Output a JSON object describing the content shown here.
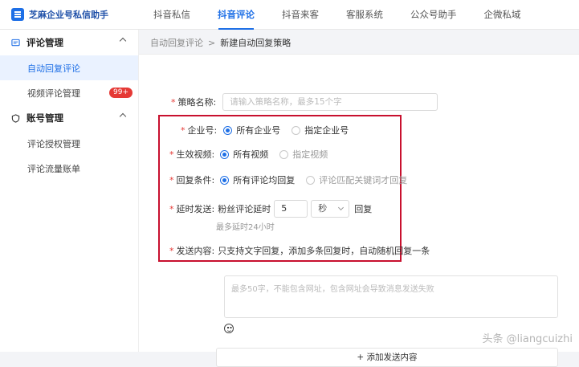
{
  "brand": {
    "name": "芝麻企业号私信助手"
  },
  "nav": [
    "抖音私信",
    "抖音评论",
    "抖音来客",
    "客服系统",
    "公众号助手",
    "企微私域"
  ],
  "nav_active_index": 1,
  "sidebar": {
    "group1": {
      "label": "评论管理",
      "icon": "comment-icon"
    },
    "items1": [
      {
        "label": "自动回复评论",
        "active": true
      },
      {
        "label": "视频评论管理",
        "badge": "99+"
      }
    ],
    "group2": {
      "label": "账号管理",
      "icon": "shield-icon"
    },
    "items2": [
      {
        "label": "评论授权管理"
      },
      {
        "label": "评论流量账单"
      }
    ]
  },
  "breadcrumb": {
    "parent": "自动回复评论",
    "sep": ">",
    "current": "新建自动回复策略"
  },
  "form": {
    "policy_name_label": "策略名称:",
    "policy_name_placeholder": "请输入策略名称，最多15个字",
    "account_label": "企业号:",
    "account_opt1": "所有企业号",
    "account_opt2": "指定企业号",
    "video_label": "生效视频:",
    "video_opt1": "所有视频",
    "video_opt2": "指定视频",
    "cond_label": "回复条件:",
    "cond_opt1": "所有评论均回复",
    "cond_opt2": "评论匹配关键词才回复",
    "delay_label": "延时发送:",
    "delay_prefix": "粉丝评论延时",
    "delay_value": "5",
    "delay_unit": "秒",
    "delay_suffix": "回复",
    "delay_hint": "最多延时24小时",
    "content_label": "发送内容:",
    "content_desc": "只支持文字回复，添加多条回复时，自动随机回复一条",
    "content_placeholder": "最多50字，不能包含网址，包含网址会导致消息发送失败",
    "add_button": "+ 添加发送内容"
  },
  "watermark": "头条 @liangcuizhi",
  "colors": {
    "accent": "#1e6fe6",
    "highlight_box": "#c8102e",
    "badge": "#e53935"
  }
}
